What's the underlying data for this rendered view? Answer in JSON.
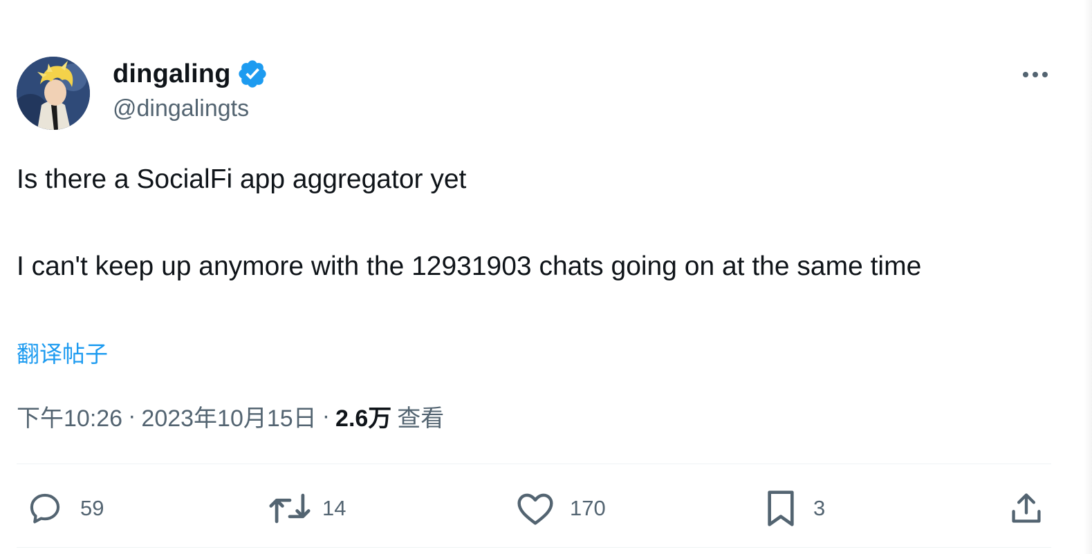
{
  "author": {
    "display_name": "dingaling",
    "handle": "@dingalingts",
    "verified": true
  },
  "tweet": {
    "paragraphs": [
      "Is there a SocialFi app aggregator yet",
      "I can't keep up anymore with the 12931903 chats going on at the same time"
    ],
    "translate_label": "翻译帖子"
  },
  "meta": {
    "time": "下午10:26",
    "separator": "·",
    "date": "2023年10月15日",
    "views_count": "2.6万",
    "views_label": "查看"
  },
  "actions": {
    "reply_count": "59",
    "repost_count": "14",
    "like_count": "170",
    "bookmark_count": "3"
  },
  "icons": {
    "verified": "verified-badge-icon",
    "more": "more-horizontal-icon",
    "reply": "reply-icon",
    "repost": "repost-icon",
    "like": "heart-icon",
    "bookmark": "bookmark-icon",
    "share": "share-icon"
  },
  "colors": {
    "accent": "#1d9bf0",
    "text_primary": "#0f1419",
    "text_secondary": "#536471"
  }
}
